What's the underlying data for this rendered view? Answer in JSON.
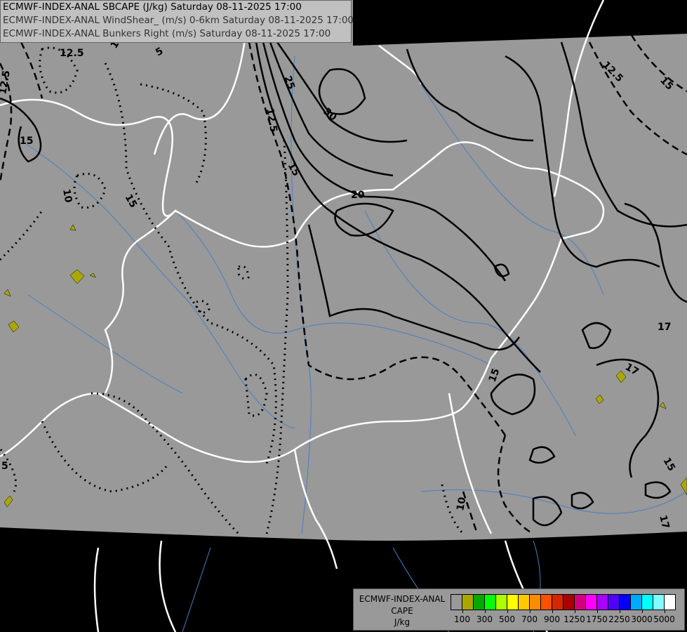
{
  "header": {
    "lines": [
      "ECMWF-INDEX-ANAL SBCAPE (J/kg) Saturday 08-11-2025 17:00",
      "ECMWF-INDEX-ANAL WindShear_ (m/s) 0-6km Saturday 08-11-2025 17:00",
      "ECMWF-INDEX-ANAL Bunkers Right (m/s) Saturday 08-11-2025 17:00"
    ]
  },
  "map": {
    "background_color": "#999999",
    "outside_color": "#000000",
    "border_color": "#ffffff",
    "river_color": "#4a7fc0",
    "contour_labels": {
      "solid": [
        "15",
        "17",
        "20",
        "25",
        "30",
        "15",
        "17",
        "15",
        "17",
        "15"
      ],
      "dashed": [
        "12.5",
        "12.5",
        "12.5",
        "15",
        "10",
        "12.5"
      ],
      "dotted": [
        "10",
        "5",
        "10",
        "15",
        "5"
      ]
    }
  },
  "legend": {
    "title": [
      "ECMWF-INDEX-ANAL",
      "CAPE",
      "J/kg"
    ],
    "colors": [
      "#999999",
      "#aaa800",
      "#00aa00",
      "#00ff00",
      "#aaff00",
      "#ffff00",
      "#ffc800",
      "#ff8c00",
      "#ff5000",
      "#d22800",
      "#aa0000",
      "#d2007d",
      "#ff00ff",
      "#aa00ff",
      "#5000ff",
      "#0000ff",
      "#00aaff",
      "#00ffff",
      "#80ffff",
      "#ffffff"
    ],
    "tick_labels": [
      "100",
      "300",
      "500",
      "700",
      "900",
      "1250",
      "1750",
      "2250",
      "3000",
      "5000"
    ]
  }
}
